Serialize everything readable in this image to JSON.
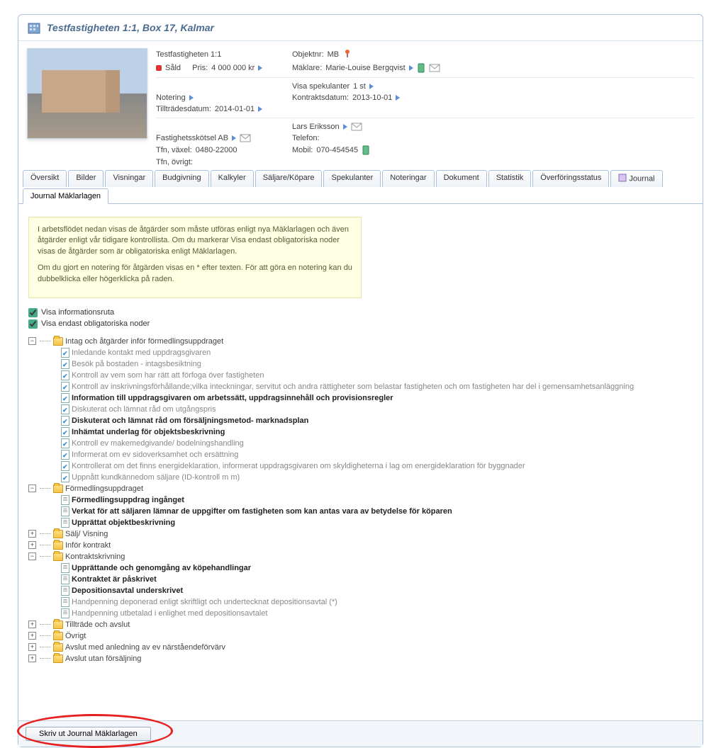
{
  "header": {
    "title": "Testfastigheten 1:1, Box 17, Kalmar"
  },
  "details": {
    "objName": "Testfastigheten 1:1",
    "objNrLabel": "Objektnr:",
    "objNr": "MB",
    "statusLabel": "Såld",
    "prisLabel": "Pris:",
    "pris": "4 000 000 kr",
    "maklareLabel": "Mäklare:",
    "maklare": "Marie-Louise Bergqvist",
    "visaSpekLabel": "Visa spekulanter",
    "visaSpekVal": "1 st",
    "noteringLabel": "Notering",
    "kontraktLabel": "Kontraktsdatum:",
    "kontraktDate": "2013-10-01",
    "tilltradeLabel": "Tillträdesdatum:",
    "tilltradeDate": "2014-01-01",
    "contactName": "Lars  Eriksson",
    "telefonLabel": "Telefon:",
    "mobilLabel": "Mobil:",
    "mobil": "070-454545",
    "companyName": "Fastighetsskötsel AB",
    "tfnVaxelLabel": "Tfn, växel:",
    "tfnVaxel": "0480-22000",
    "tfnOvrigtLabel": "Tfn, övrigt:"
  },
  "tabs": [
    "Översikt",
    "Bilder",
    "Visningar",
    "Budgivning",
    "Kalkyler",
    "Säljare/Köpare",
    "Spekulanter",
    "Noteringar",
    "Dokument",
    "Statistik",
    "Överföringsstatus",
    "Journal",
    "Journal Mäklarlagen"
  ],
  "activeTab": 12,
  "infoBox": {
    "p1": "I arbetsflödet nedan visas de åtgärder som måste utföras enligt nya Mäklarlagen och även åtgärder enligt vår tidigare kontrollista. Om du markerar Visa endast obligatoriska noder visas de åtgärder som är obligatoriska enligt Mäklarlagen.",
    "p2": "Om du gjort en notering för åtgärden visas en * efter texten. För att göra en notering kan du dubbelklicka eller högerklicka på raden."
  },
  "checkboxes": {
    "cb1": "Visa informationsruta",
    "cb2": "Visa endast obligatoriska noder"
  },
  "tree": [
    {
      "type": "folder",
      "toggle": "-",
      "label": "Intag och åtgärder inför förmedlingsuppdraget",
      "children": [
        {
          "type": "leaf",
          "icon": "check",
          "style": "grey",
          "label": "Inledande kontakt med uppdragsgivaren"
        },
        {
          "type": "leaf",
          "icon": "check",
          "style": "grey",
          "label": "Besök på bostaden - intagsbesiktning"
        },
        {
          "type": "leaf",
          "icon": "check",
          "style": "grey",
          "label": "Kontroll av vem som har rätt att förfoga över fastigheten"
        },
        {
          "type": "leaf",
          "icon": "check",
          "style": "grey",
          "label": "Kontroll av inskrivningsförhållande;vilka inteckningar, servitut och andra rättigheter som belastar fastigheten och om fastigheten har del i gemensamhetsanläggning"
        },
        {
          "type": "leaf",
          "icon": "check",
          "style": "bold",
          "label": "Information till uppdragsgivaren om arbetssätt, uppdragsinnehåll och provisionsregler"
        },
        {
          "type": "leaf",
          "icon": "check",
          "style": "grey",
          "label": "Diskuterat och lämnat råd om utgångspris"
        },
        {
          "type": "leaf",
          "icon": "check",
          "style": "bold",
          "label": "Diskuterat och lämnat råd om försäljningsmetod- marknadsplan"
        },
        {
          "type": "leaf",
          "icon": "check",
          "style": "bold",
          "label": "Inhämtat underlag för objektsbeskrivning"
        },
        {
          "type": "leaf",
          "icon": "check",
          "style": "grey",
          "label": "Kontroll ev makemedgivande/ bodelningshandling"
        },
        {
          "type": "leaf",
          "icon": "check",
          "style": "grey",
          "label": "Informerat om ev sidoverksamhet och ersättning"
        },
        {
          "type": "leaf",
          "icon": "check",
          "style": "grey",
          "label": "Kontrollerat om det finns energideklaration, informerat uppdragsgivaren om skyldigheterna i lag om energideklaration för byggnader"
        },
        {
          "type": "leaf",
          "icon": "check",
          "style": "grey",
          "label": "Uppnått kundkännedom säljare (ID-kontroll m m)"
        }
      ]
    },
    {
      "type": "folder",
      "toggle": "-",
      "label": "Förmedlingsuppdraget",
      "children": [
        {
          "type": "leaf",
          "icon": "plain",
          "style": "bold",
          "label": "Förmedlingsuppdrag ingånget"
        },
        {
          "type": "leaf",
          "icon": "plain",
          "style": "bold",
          "label": "Verkat för att säljaren lämnar de uppgifter om fastigheten som kan antas vara av betydelse för köparen"
        },
        {
          "type": "leaf",
          "icon": "plain",
          "style": "bold",
          "label": "Upprättat objektbeskrivning"
        }
      ]
    },
    {
      "type": "folder",
      "toggle": "+",
      "label": "Sälj/ Visning"
    },
    {
      "type": "folder",
      "toggle": "+",
      "label": "Inför kontrakt"
    },
    {
      "type": "folder",
      "toggle": "-",
      "label": "Kontraktskrivning",
      "children": [
        {
          "type": "leaf",
          "icon": "plain",
          "style": "bold",
          "label": "Upprättande och genomgång av köpehandlingar"
        },
        {
          "type": "leaf",
          "icon": "plain",
          "style": "bold",
          "label": "Kontraktet är påskrivet"
        },
        {
          "type": "leaf",
          "icon": "plain",
          "style": "bold",
          "label": "Depositionsavtal underskrivet"
        },
        {
          "type": "leaf",
          "icon": "plain",
          "style": "grey",
          "label": "Handpenning deponerad enligt skriftligt och undertecknat depositionsavtal (*)"
        },
        {
          "type": "leaf",
          "icon": "plain",
          "style": "grey",
          "label": "Handpenning utbetalad i enlighet med depositionsavtalet"
        }
      ]
    },
    {
      "type": "folder",
      "toggle": "+",
      "label": "Tillträde och avslut"
    },
    {
      "type": "folder",
      "toggle": "+",
      "label": "Övrigt"
    },
    {
      "type": "folder",
      "toggle": "+",
      "label": "Avslut med anledning av ev närståendeförvärv"
    },
    {
      "type": "folder",
      "toggle": "+",
      "label": "Avslut utan försäljning"
    }
  ],
  "footer": {
    "printBtn": "Skriv ut Journal Mäklarlagen"
  }
}
